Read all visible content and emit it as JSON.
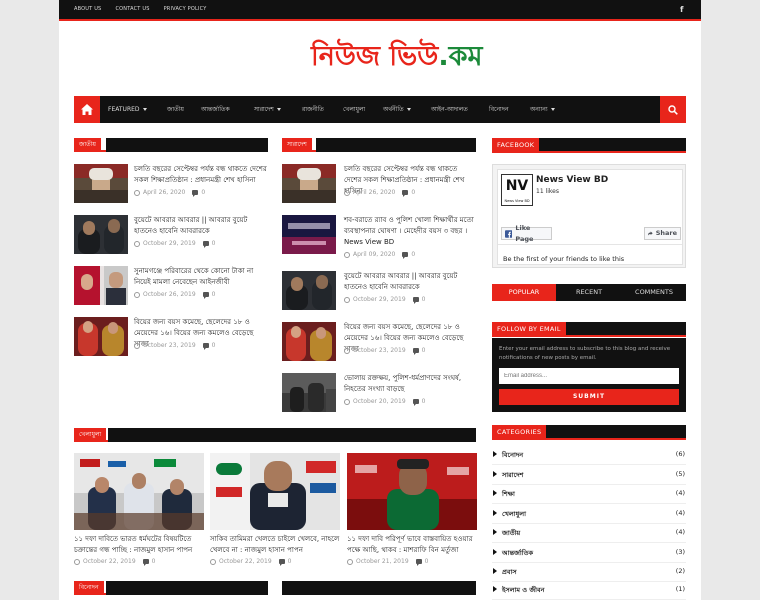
{
  "topbar": {
    "links": [
      "ABOUT US",
      "CONTACT US",
      "PRIVACY POLICY"
    ],
    "fb_icon": "f"
  },
  "logo": {
    "part1": "নিউজ ভিউ",
    "part2": ".কম"
  },
  "nav": {
    "items": [
      "FEATURED",
      "জাতীয়",
      "আন্তর্জাতিক",
      "সারাদেশ",
      "রাজনীতি",
      "খেলাধুলা",
      "অর্থনীতি",
      "আইন-আদালত",
      "বিনোদন",
      "অন্যান্য"
    ]
  },
  "sections": {
    "national": "জাতীয়",
    "countrywide": "সারাদেশ",
    "sports": "খেলাধুলা",
    "entertainment": "বিনোদন"
  },
  "national_posts": [
    {
      "title": "চলতি বছরের সেপ্টেম্বর পর্যন্ত বন্ধ থাকতে দেশের সকল শিক্ষাপ্রতিষ্ঠান : প্রধানমন্ত্রী শেখ হাসিনা",
      "date": "April 26, 2020",
      "comments": "0"
    },
    {
      "title": "বুয়েটে আবরার আবরার || আবরার বুয়েট হাতনেও হাবেনি আবরারকে",
      "date": "October 29, 2019",
      "comments": "0"
    },
    {
      "title": "সুনামগঞ্জে পরিবারের থেকে কোনো টাকা না নিয়েই মামলা নেবেছেন আইনজীবী",
      "date": "October 26, 2019",
      "comments": "0"
    },
    {
      "title": "বিয়ের জন্য বয়স কমেছে, ছেলেদের ১৮ ও মেয়েদের ১৬। বিয়ের জন্য কমলেও বেড়েছে সাজা",
      "date": "October 23, 2019",
      "comments": "0"
    }
  ],
  "country_posts": [
    {
      "title": "চলতি বছরের সেপ্টেম্বর পর্যন্ত বন্ধ থাকতে দেশের সকল শিক্ষাপ্রতিষ্ঠান : প্রধানমন্ত্রী শেখ হাসিনা",
      "date": "April 26, 2020",
      "comments": "0"
    },
    {
      "title": "শব-বরাতে র‍্যাব ও পুলিশ খোলা শিক্ষার্থীর মতো ব্যবস্থাপনার ঘোষণা । মেহেদীর বয়স ৩ বছর । News View BD",
      "date": "April 09, 2020",
      "comments": "0"
    },
    {
      "title": "বুয়েটে আবরার আবরার || আবরার বুয়েট হাতনেও হাবেনি আবরারকে",
      "date": "October 29, 2019",
      "comments": "0"
    },
    {
      "title": "বিয়ের জন্য বয়স কমেছে, ছেলেদের ১৮ ও মেয়েদের ১৬। বিয়ের জন্য কমলেও বেড়েছে সাজা",
      "date": "October 23, 2019",
      "comments": "0"
    },
    {
      "title": "ভোলায় রক্তক্ষয়, পুলিশ-ধর্মপ্রাণদের সংঘর্ষ, নিহতের সংখ্যা বাড়ছে",
      "date": "October 20, 2019",
      "comments": "0"
    }
  ],
  "sports_posts": [
    {
      "title": "১১ দফা দাবিতে ভারত ধর্মঘটের বিষয়টিতে চক্রান্তের গন্ধ পাচ্ছি : নাজমুল হাসান পাপন",
      "date": "October 22, 2019",
      "comments": "0"
    },
    {
      "title": "সাকিব তামিমরা খেলতে চাইলে খেলবে, নাহলে খেলবে না : নাজমুল হাসান পাপন",
      "date": "October 22, 2019",
      "comments": "0"
    },
    {
      "title": "১১ দফা দাবি পরিপূর্ণ ভাবে বাস্তবায়িত হওয়ার পক্ষে আছি, থাকব : মাশরাফি বিন মর্তুজা",
      "date": "October 21, 2019",
      "comments": "0"
    }
  ],
  "sidebar": {
    "facebook_title": "FACEBOOK",
    "fb_page_name": "News View BD",
    "fb_likes": "11 likes",
    "fb_logo_text": "NV",
    "fb_logo_sub": "News View BD",
    "fb_like_btn": "Like Page",
    "fb_share_btn": "Share",
    "fb_friends": "Be the first of your friends to like this",
    "tabs": [
      "POPULAR",
      "RECENT",
      "COMMENTS"
    ],
    "follow_title": "FOLLOW BY EMAIL",
    "follow_text": "Enter your email address to subscribe to this blog and receive notifications of new posts by email.",
    "email_placeholder": "Email address...",
    "submit": "SUBMIT",
    "categories_title": "CATEGORIES",
    "categories": [
      {
        "name": "বিনোদন",
        "count": "(6)"
      },
      {
        "name": "সারাদেশ",
        "count": "(5)"
      },
      {
        "name": "শিক্ষা",
        "count": "(4)"
      },
      {
        "name": "খেলাধুলা",
        "count": "(4)"
      },
      {
        "name": "জাতীয়",
        "count": "(4)"
      },
      {
        "name": "আন্তর্জাতিক",
        "count": "(3)"
      },
      {
        "name": "প্রবাস",
        "count": "(2)"
      },
      {
        "name": "ইসলাম ও জীবন",
        "count": "(1)"
      }
    ]
  },
  "colors": {
    "accent": "#e8251b",
    "dark": "#111111",
    "logo_green": "#1c8a3a"
  }
}
